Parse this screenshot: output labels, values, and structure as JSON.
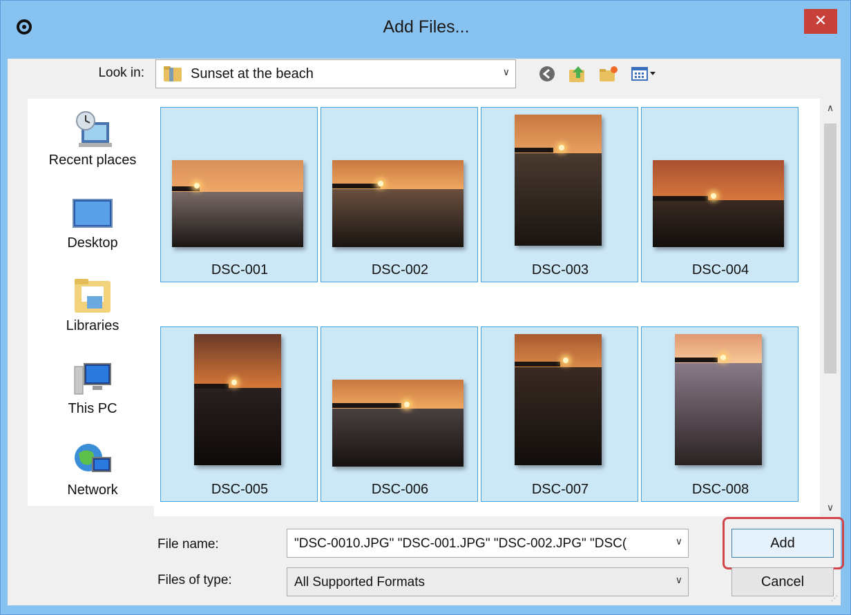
{
  "window": {
    "title": "Add Files...",
    "close_label": "✕"
  },
  "toolbar": {
    "look_in_label": "Look in:",
    "look_in_value": "Sunset at the beach",
    "buttons": [
      "back",
      "up-one-level",
      "create-new-folder",
      "view-menu"
    ]
  },
  "places": [
    {
      "label": "Recent places",
      "icon": "recent-places-icon"
    },
    {
      "label": "Desktop",
      "icon": "desktop-icon"
    },
    {
      "label": "Libraries",
      "icon": "libraries-icon"
    },
    {
      "label": "This PC",
      "icon": "this-pc-icon"
    },
    {
      "label": "Network",
      "icon": "network-icon"
    }
  ],
  "files": [
    {
      "name": "DSC-001",
      "orientation": "landscape",
      "selected": true
    },
    {
      "name": "DSC-002",
      "orientation": "landscape",
      "selected": true
    },
    {
      "name": "DSC-003",
      "orientation": "portrait",
      "selected": true
    },
    {
      "name": "DSC-004",
      "orientation": "landscape",
      "selected": true
    },
    {
      "name": "DSC-005",
      "orientation": "portrait",
      "selected": true
    },
    {
      "name": "DSC-006",
      "orientation": "landscape",
      "selected": true
    },
    {
      "name": "DSC-007",
      "orientation": "portrait",
      "selected": true
    },
    {
      "name": "DSC-008",
      "orientation": "portrait",
      "selected": true
    }
  ],
  "form": {
    "file_name_label": "File name:",
    "file_name_value": "\"DSC-0010.JPG\" \"DSC-001.JPG\" \"DSC-002.JPG\" \"DSC(",
    "file_type_label": "Files of type:",
    "file_type_value": "All Supported Formats"
  },
  "buttons": {
    "add": "Add",
    "cancel": "Cancel"
  },
  "colors": {
    "titlebar": "#88c2f0",
    "close": "#c7403a",
    "selection": "#cce8f7",
    "selection_border": "#3fa2dc",
    "highlight": "#d0454a"
  }
}
